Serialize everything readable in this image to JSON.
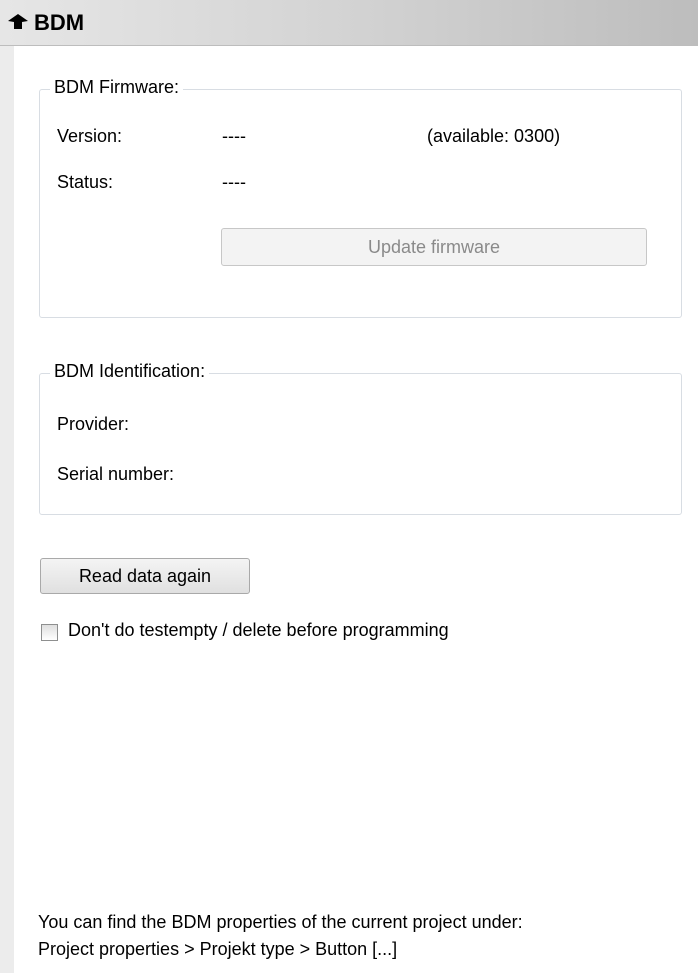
{
  "header": {
    "title": "BDM",
    "icon": "chip-icon"
  },
  "firmware_group": {
    "legend": "BDM Firmware:",
    "version_label": "Version:",
    "version_value": "----",
    "available_text": "(available: 0300)",
    "status_label": "Status:",
    "status_value": "----",
    "update_button": "Update firmware"
  },
  "identification_group": {
    "legend": "BDM Identification:",
    "provider_label": "Provider:",
    "serial_label": "Serial number:"
  },
  "read_button": "Read data again",
  "checkbox": {
    "label": "Don't do testempty / delete before programming",
    "checked": false
  },
  "footer": {
    "line1": "You can find the BDM properties of the current project under:",
    "line2": "Project properties > Projekt type > Button [...]"
  }
}
